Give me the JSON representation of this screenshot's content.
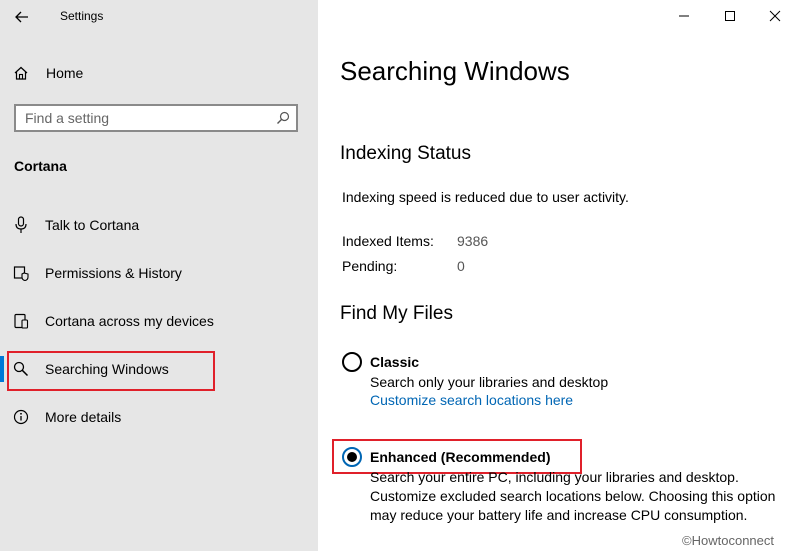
{
  "window": {
    "title": "Settings"
  },
  "sidebar": {
    "home_label": "Home",
    "search": {
      "placeholder": "Find a setting"
    },
    "section_label": "Cortana",
    "items": [
      {
        "label": "Talk to Cortana",
        "icon": "microphone-icon"
      },
      {
        "label": "Permissions & History",
        "icon": "permissions-shield-icon"
      },
      {
        "label": "Cortana across my devices",
        "icon": "devices-icon"
      },
      {
        "label": "Searching Windows",
        "icon": "search-icon",
        "selected": true
      },
      {
        "label": "More details",
        "icon": "info-icon"
      }
    ]
  },
  "main": {
    "title": "Searching Windows",
    "indexing": {
      "heading": "Indexing Status",
      "status_text": "Indexing speed is reduced due to user activity.",
      "indexed_label": "Indexed Items:",
      "indexed_value": "9386",
      "pending_label": "Pending:",
      "pending_value": "0"
    },
    "find_files": {
      "heading": "Find My Files",
      "classic": {
        "label": "Classic",
        "description": "Search only your libraries and desktop",
        "link": "Customize search locations here",
        "selected": false
      },
      "enhanced": {
        "label": "Enhanced (Recommended)",
        "description_line1": "Search your entire PC, including your libraries and desktop.",
        "description_line2": "Customize excluded search locations below. Choosing this option",
        "description_line3": "may reduce your battery life and increase CPU consumption.",
        "selected": true
      }
    }
  },
  "watermark": "©Howtoconnect",
  "colors": {
    "accent": "#0078d7",
    "link": "#0066b4",
    "highlight": "#e0202a",
    "sidebar_bg": "#e6e6e6"
  }
}
